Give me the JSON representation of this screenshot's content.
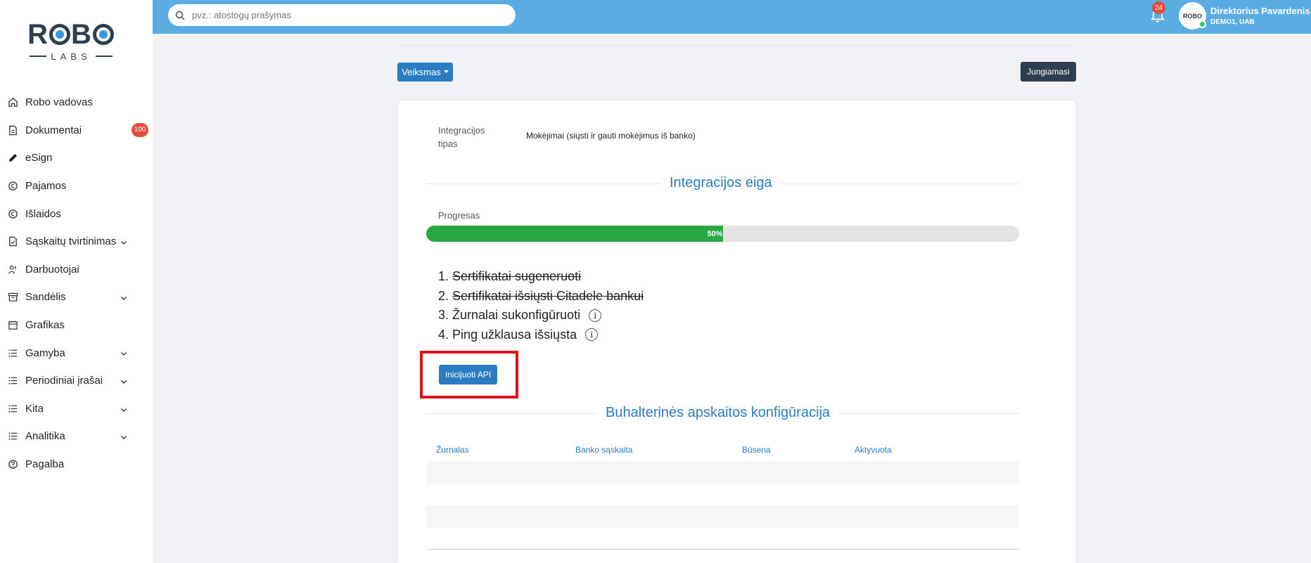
{
  "sidebar": {
    "logo_top": "ROBO",
    "logo_bottom": "LABS",
    "items": [
      {
        "label": "Robo vadovas",
        "icon": "home-icon",
        "chevron": false
      },
      {
        "label": "Dokumentai",
        "icon": "document-icon",
        "chevron": false,
        "badge": "100"
      },
      {
        "label": "eSign",
        "icon": "pen-icon",
        "chevron": false
      },
      {
        "label": "Pajamos",
        "icon": "income-icon",
        "chevron": false
      },
      {
        "label": "Išlaidos",
        "icon": "expense-icon",
        "chevron": false
      },
      {
        "label": "Sąskaitų tvirtinimas",
        "icon": "invoice-check-icon",
        "chevron": true
      },
      {
        "label": "Darbuotojai",
        "icon": "users-icon",
        "chevron": false
      },
      {
        "label": "Sandėlis",
        "icon": "warehouse-icon",
        "chevron": true
      },
      {
        "label": "Grafikas",
        "icon": "calendar-icon",
        "chevron": false
      },
      {
        "label": "Gamyba",
        "icon": "list-icon",
        "chevron": true
      },
      {
        "label": "Periodiniai įrašai",
        "icon": "list-icon",
        "chevron": true
      },
      {
        "label": "Kita",
        "icon": "list-icon",
        "chevron": true
      },
      {
        "label": "Analitika",
        "icon": "list-icon",
        "chevron": true
      },
      {
        "label": "Pagalba",
        "icon": "help-icon",
        "chevron": false
      }
    ]
  },
  "topbar": {
    "search_placeholder": "pvz.: atostogų prašymas",
    "notification_count": "24",
    "user_name": "Direktorius Pavardenis",
    "user_company": "DEMO1, UAB",
    "avatar_text": "ROBO"
  },
  "toolbar": {
    "action_label": "Veiksmas",
    "connecting_label": "Jungiamasi"
  },
  "integration": {
    "type_label": "Integracijos tipas",
    "type_value": "Mokėjimai (siųsti ir gauti mokėjimus iš banko)",
    "flow_title": "Integracijos eiga",
    "progress_label": "Progresas",
    "progress_percent": 50,
    "progress_text": "50%",
    "steps": [
      {
        "num": "1.",
        "text": "Sertifikatai sugeneruoti",
        "done": true,
        "info": false
      },
      {
        "num": "2.",
        "text": "Sertifikatai išsiųsti Citadele bankui",
        "done": true,
        "info": false
      },
      {
        "num": "3.",
        "text": "Žurnalai sukonfigūruoti",
        "done": false,
        "info": true
      },
      {
        "num": "4.",
        "text": "Ping užklausa išsiųsta",
        "done": false,
        "info": true
      }
    ],
    "init_api_label": "Inicijuoti API"
  },
  "accounting": {
    "title": "Buhalterinės apskaitos konfigūracija",
    "columns": [
      "Žurnalas",
      "Banko sąskaita",
      "Būsena",
      "Aktyvuota"
    ]
  },
  "colors": {
    "topbar": "#5aace2",
    "primary": "#2b7cc1",
    "dark": "#2d3e50",
    "progress": "#28a745",
    "badge": "#e74c3c",
    "highlight": "#e0101f"
  }
}
